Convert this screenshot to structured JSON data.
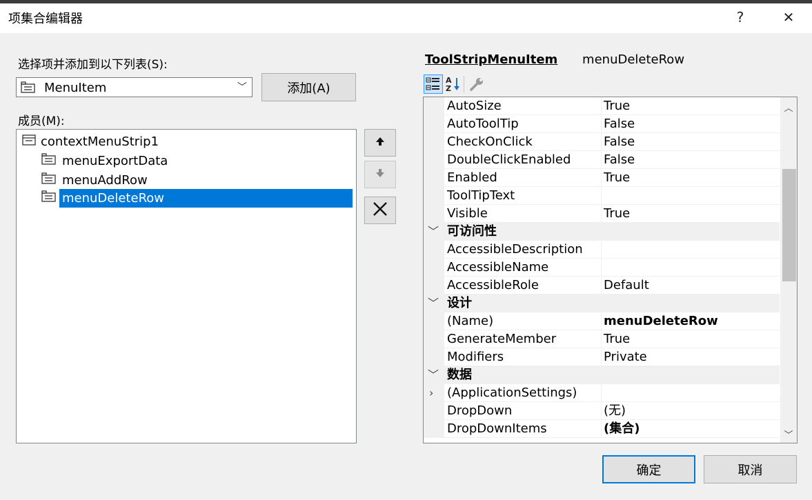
{
  "window": {
    "title": "项集合编辑器",
    "help_label": "?",
    "close_label": "✕"
  },
  "left": {
    "select_label": "选择项并添加到以下列表(S):",
    "combo_value": "MenuItem",
    "add_button": "添加(A)",
    "members_label": "成员(M):",
    "tree": [
      {
        "label": "contextMenuStrip1",
        "level": 0,
        "selected": false
      },
      {
        "label": "menuExportData",
        "level": 1,
        "selected": false
      },
      {
        "label": "menuAddRow",
        "level": 1,
        "selected": false
      },
      {
        "label": "menuDeleteRow",
        "level": 1,
        "selected": true
      }
    ]
  },
  "side_buttons": {
    "up_icon": "arrow-up-icon",
    "down_icon": "arrow-down-icon",
    "delete_icon": "delete-x-icon"
  },
  "properties": {
    "type_name": "ToolStripMenuItem",
    "object_name": "menuDeleteRow",
    "rows": [
      {
        "kind": "prop",
        "name": "AutoSize",
        "value": "True"
      },
      {
        "kind": "prop",
        "name": "AutoToolTip",
        "value": "False"
      },
      {
        "kind": "prop",
        "name": "CheckOnClick",
        "value": "False"
      },
      {
        "kind": "prop",
        "name": "DoubleClickEnabled",
        "value": "False"
      },
      {
        "kind": "prop",
        "name": "Enabled",
        "value": "True"
      },
      {
        "kind": "prop",
        "name": "ToolTipText",
        "value": ""
      },
      {
        "kind": "prop",
        "name": "Visible",
        "value": "True"
      },
      {
        "kind": "cat",
        "name": "可访问性",
        "value": ""
      },
      {
        "kind": "prop",
        "name": "AccessibleDescription",
        "value": ""
      },
      {
        "kind": "prop",
        "name": "AccessibleName",
        "value": ""
      },
      {
        "kind": "prop",
        "name": "AccessibleRole",
        "value": "Default"
      },
      {
        "kind": "cat",
        "name": "设计",
        "value": ""
      },
      {
        "kind": "prop",
        "name": "(Name)",
        "value": "menuDeleteRow",
        "bold": true
      },
      {
        "kind": "prop",
        "name": "GenerateMember",
        "value": "True"
      },
      {
        "kind": "prop",
        "name": "Modifiers",
        "value": "Private"
      },
      {
        "kind": "cat",
        "name": "数据",
        "value": ""
      },
      {
        "kind": "prop",
        "name": "(ApplicationSettings)",
        "value": "",
        "expandable": true
      },
      {
        "kind": "prop",
        "name": "DropDown",
        "value": "(无)"
      },
      {
        "kind": "prop",
        "name": "DropDownItems",
        "value": "(集合)",
        "bold": true
      }
    ]
  },
  "footer": {
    "ok_button": "确定",
    "cancel_button": "取消"
  }
}
